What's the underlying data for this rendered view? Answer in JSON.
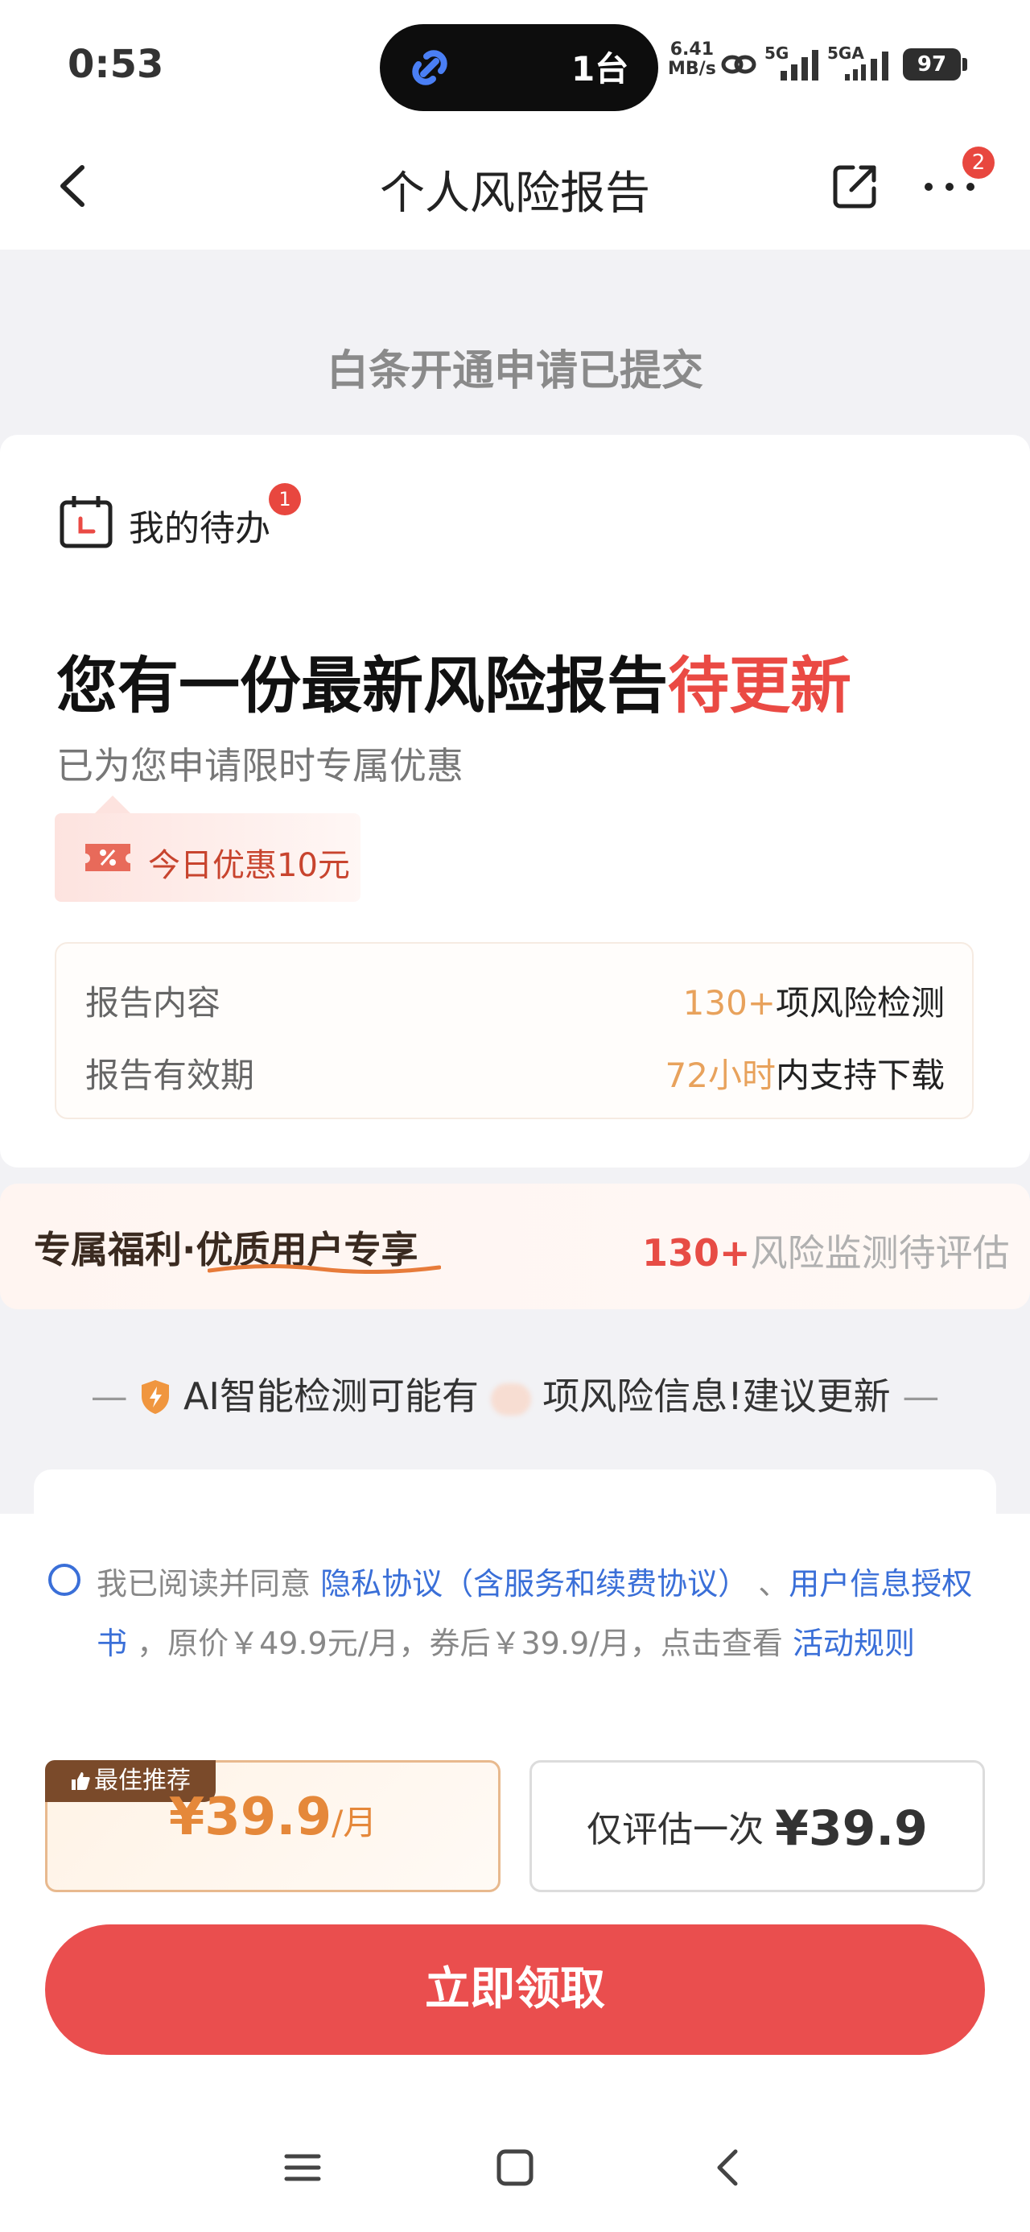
{
  "status_bar": {
    "time": "0:53",
    "island_text": "1台",
    "net_speed_value": "6.41",
    "net_speed_unit": "MB/s",
    "signal_1": "5G",
    "signal_2": "5GA",
    "battery": "97"
  },
  "nav": {
    "title": "个人风险报告",
    "more_badge": "2"
  },
  "banner": {
    "text": "白条开通申请已提交"
  },
  "todo": {
    "label": "我的待办",
    "badge": "1"
  },
  "report": {
    "headline_main": "您有一份最新风险报告",
    "headline_highlight": "待更新",
    "subline": "已为您申请限时专属优惠",
    "coupon": "今日优惠10元",
    "rows": [
      {
        "label": "报告内容",
        "value_highlight": "130+",
        "value_rest": "项风险检测"
      },
      {
        "label": "报告有效期",
        "value_highlight": "72小时",
        "value_rest": "内支持下载"
      }
    ]
  },
  "perk": {
    "left_prefix": "专属福利·",
    "left_emph": "优质用户专享",
    "right_num": "130+",
    "right_text": "风险监测待评估"
  },
  "ai": {
    "before": "AI智能检测可能有",
    "after": "项风险信息!建议更新",
    "dash": "—"
  },
  "agreement": {
    "prefix": "我已阅读并同意 ",
    "link1": "隐私协议（含服务和续费协议）",
    "sep": " 、",
    "link2": "用户信息授权书",
    "middle": " ，原价￥49.9元/月，券后￥39.9/月，点击查看 ",
    "link3": "活动规则"
  },
  "plans": {
    "badge": "最佳推荐",
    "monthly_price": "¥39.9",
    "monthly_unit": "/月",
    "once_label": "仅评估一次 ",
    "once_price": "¥39.9"
  },
  "cta": {
    "label": "立即领取"
  },
  "colors": {
    "accent_red": "#ea4e4e",
    "link_blue": "#3a6fd8",
    "highlight_orange": "#e8a25c"
  }
}
